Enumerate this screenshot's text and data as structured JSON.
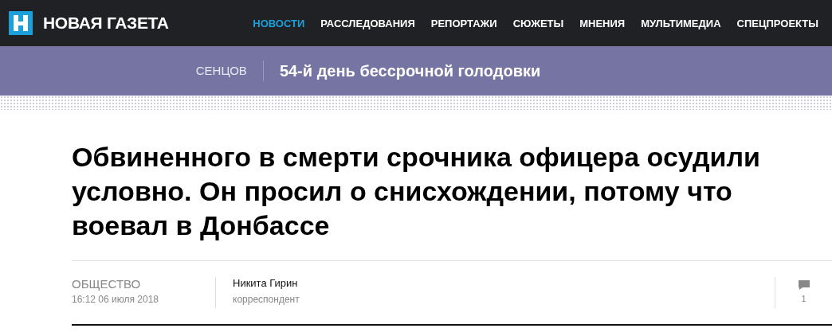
{
  "header": {
    "logo_text": "НОВАЯ ГАЗЕТА",
    "nav": [
      {
        "label": "НОВОСТИ",
        "selected": true
      },
      {
        "label": "РАССЛЕДОВАНИЯ",
        "selected": false
      },
      {
        "label": "РЕПОРТАЖИ",
        "selected": false
      },
      {
        "label": "СЮЖЕТЫ",
        "selected": false
      },
      {
        "label": "МНЕНИЯ",
        "selected": false
      },
      {
        "label": "МУЛЬТИМЕДИА",
        "selected": false
      },
      {
        "label": "СПЕЦПРОЕКТЫ",
        "selected": false
      }
    ]
  },
  "topic_band": {
    "tag": "СЕНЦОВ",
    "headline": "54-й день бессрочной голодовки"
  },
  "article": {
    "title": "Обвиненного в смерти срочника офицера осудили условно. Он просил о снисхождении, потому что воевал в Донбассе",
    "rubric": "ОБЩЕСТВО",
    "date": "16:12 06 июля 2018",
    "author": "Никита Гирин",
    "author_role": "корреспондент",
    "comments": "1"
  }
}
